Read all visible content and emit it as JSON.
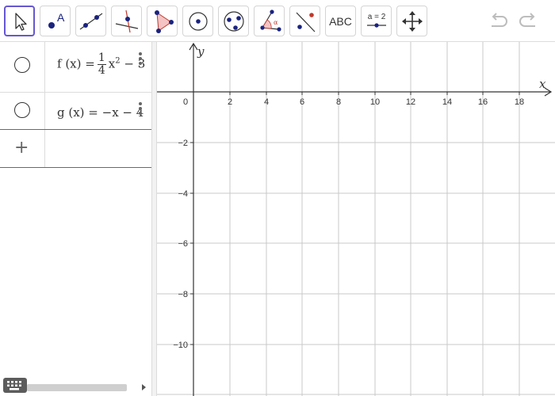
{
  "toolbar": {
    "tools": [
      {
        "name": "move-tool",
        "icon": "cursor-arrow-icon",
        "active": true
      },
      {
        "name": "point-tool",
        "icon": "point-label-icon",
        "label": "A"
      },
      {
        "name": "line-tool",
        "icon": "line-through-points-icon"
      },
      {
        "name": "perpendicular-line-tool",
        "icon": "perpendicular-line-icon"
      },
      {
        "name": "polygon-tool",
        "icon": "polygon-icon"
      },
      {
        "name": "circle-center-point-tool",
        "icon": "circle-center-icon"
      },
      {
        "name": "circle-three-points-tool",
        "icon": "circle-three-points-icon"
      },
      {
        "name": "angle-tool",
        "icon": "angle-icon",
        "label": "α"
      },
      {
        "name": "reflect-tool",
        "icon": "reflect-about-line-icon"
      },
      {
        "name": "text-tool",
        "icon": "text-icon",
        "label": "ABC"
      },
      {
        "name": "slider-tool",
        "icon": "slider-icon",
        "label": "a = 2"
      },
      {
        "name": "move-graphics-view-tool",
        "icon": "move-cross-arrows-icon"
      }
    ],
    "undo_icon": "undo-icon",
    "redo_icon": "redo-icon"
  },
  "algebra": {
    "rows": [
      {
        "f_prefix": "f (x)  =",
        "frac_num": "1",
        "frac_den": "4",
        "term": "x",
        "exponent": "2",
        "rest": " − 3"
      },
      {
        "g_text": "g (x)  =  −x − 4"
      }
    ],
    "add_label": "+"
  },
  "graph": {
    "x_axis_name": "x",
    "y_axis_name": "y",
    "origin_label": "0",
    "x_ticks": [
      "2",
      "4",
      "6",
      "8",
      "10",
      "12",
      "14",
      "16",
      "18"
    ],
    "y_ticks": [
      "−2",
      "−4",
      "−6",
      "−8",
      "−10"
    ]
  },
  "colors": {
    "accent": "#6557d2",
    "point": "#1a237e",
    "polygon_fill": "#f4c3c3",
    "polygon_stroke": "#c0392b",
    "grid": "#c8c8c8"
  }
}
